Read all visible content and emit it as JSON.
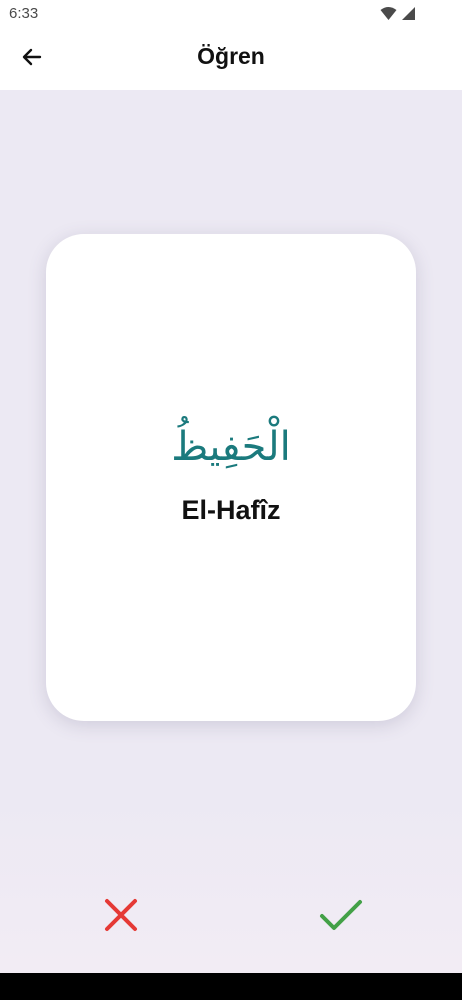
{
  "status_bar": {
    "time": "6:33",
    "icons": [
      "wifi-icon",
      "signal-icon"
    ]
  },
  "app_bar": {
    "back_icon": "arrow-left-icon",
    "title": "Öğren"
  },
  "card": {
    "arabic": "الْحَفِيظُ",
    "transliteration": "El-Hafîz"
  },
  "actions": {
    "wrong_icon": "close-icon",
    "correct_icon": "check-icon"
  },
  "colors": {
    "accent_teal": "#1b7a7d",
    "wrong_red": "#e53935",
    "correct_green": "#43a047",
    "background": "#edeaf4"
  }
}
